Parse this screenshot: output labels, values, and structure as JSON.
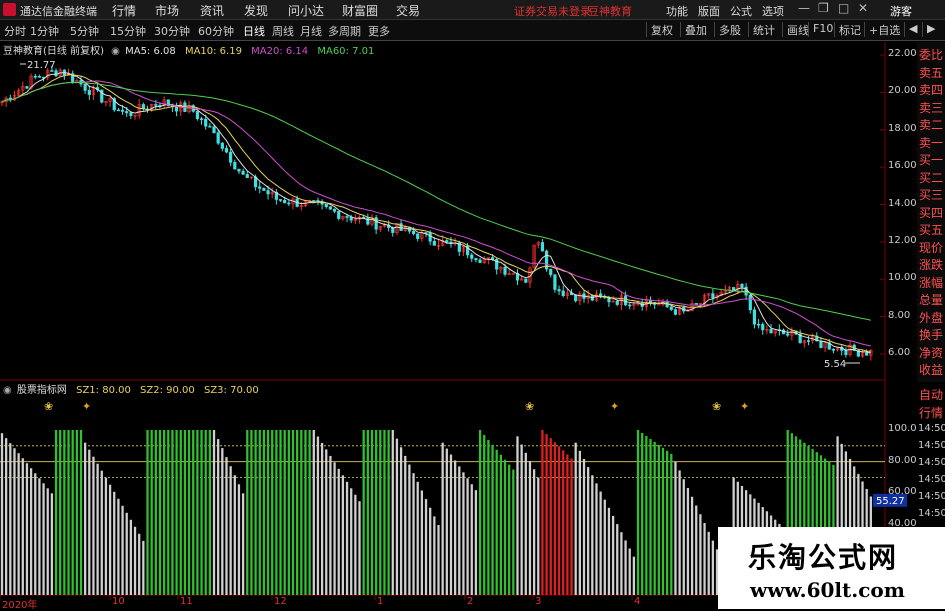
{
  "app": {
    "title": "通达信金融终端",
    "menus": [
      "行情",
      "市场",
      "资讯",
      "发现",
      "问小达",
      "财富圈",
      "交易"
    ],
    "warning": "证券交易未登录",
    "brand": "豆神教育",
    "right_menus": [
      "功能",
      "版面",
      "公式",
      "选项"
    ],
    "user": "游客"
  },
  "periods": [
    "分时",
    "1分钟",
    "5分钟",
    "15分钟",
    "30分钟",
    "60分钟",
    "日线",
    "周线",
    "月线",
    "多周期",
    "更多"
  ],
  "active_period": "日线",
  "toolbar": {
    "buttons": [
      "复权",
      "叠加",
      "多股",
      "统计",
      "画线",
      "F10",
      "标记",
      "+自选"
    ],
    "back_icon": "arrow-left-icon",
    "forward_icon": "arrow-right-icon"
  },
  "main_chart": {
    "title": "豆神教育(日线 前复权)",
    "ma_legend": [
      {
        "label": "MA5: 6.08",
        "color": "#e0e0e0"
      },
      {
        "label": "MA10: 6.19",
        "color": "#e8d060"
      },
      {
        "label": "MA20: 6.14",
        "color": "#d050d0"
      },
      {
        "label": "MA60: 7.01",
        "color": "#50d050"
      }
    ],
    "y_ticks": [
      "22.00",
      "20.00",
      "18.00",
      "16.00",
      "14.00",
      "12.00",
      "10.00",
      "8.00",
      "6.00"
    ],
    "high_label": "21.77",
    "low_label": "5.54"
  },
  "sub_chart": {
    "title": "股票指标网",
    "legend": [
      {
        "label": "SZ1: 80.00",
        "color": "#e8d060"
      },
      {
        "label": "SZ2: 90.00",
        "color": "#e8d060"
      },
      {
        "label": "SZ3: 70.00",
        "color": "#e8d060"
      }
    ],
    "y_ticks": [
      "100.0",
      "80.00",
      "60.00",
      "40.00"
    ],
    "current_value": "55.27"
  },
  "x_axis": [
    "2020年",
    "10",
    "11",
    "12",
    "1",
    "2",
    "3",
    "4"
  ],
  "right_panel": {
    "items": [
      "委比",
      "卖五",
      "卖四",
      "卖三",
      "卖二",
      "卖一",
      "买一",
      "买二",
      "买三",
      "买四",
      "买五",
      "现价",
      "涨跌",
      "涨幅",
      "总量",
      "外盘",
      "换手",
      "净资",
      "收益"
    ],
    "lower_items": [
      "自动",
      "行情"
    ],
    "times": [
      "14:50",
      "14:50",
      "14:50",
      "14:50",
      "14:50",
      "14:50"
    ]
  },
  "watermark": {
    "line1": "乐淘公式网",
    "line2": "www.60lt.com"
  },
  "colors": {
    "up": "#ff3030",
    "down": "#40e0e0",
    "green_bar": "#30c030",
    "red_bar": "#e02020",
    "white_bar": "#d0d0d0",
    "ma5": "#e0e0e0",
    "ma10": "#e8d060",
    "ma20": "#d050d0",
    "ma60": "#50d050"
  }
}
